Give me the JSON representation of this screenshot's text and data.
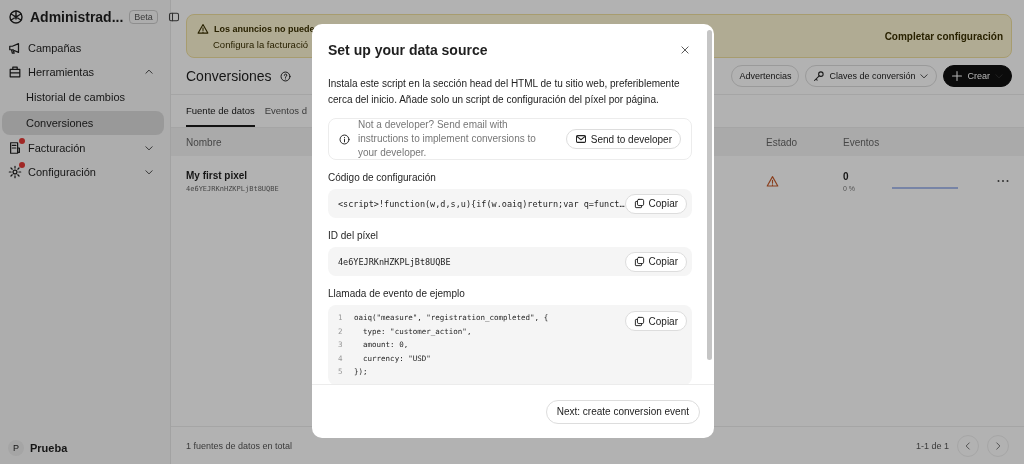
{
  "sidebar": {
    "brand": "Administrad...",
    "badge": "Beta",
    "items": [
      {
        "label": "Campañas",
        "selected": false,
        "alert": false
      },
      {
        "label": "Herramientas",
        "selected": false,
        "alert": false,
        "expanded": true,
        "children": [
          {
            "label": "Historial de cambios",
            "selected": false
          },
          {
            "label": "Conversiones",
            "selected": true
          }
        ]
      },
      {
        "label": "Facturación",
        "selected": false,
        "alert": true,
        "expanded": false
      },
      {
        "label": "Configuración",
        "selected": false,
        "alert": true,
        "expanded": false
      }
    ],
    "user": {
      "initial": "P",
      "name": "Prueba"
    }
  },
  "banner": {
    "title": "Los anuncios no puede",
    "text": "Configura la facturació",
    "action": "Completar configuración"
  },
  "header": {
    "title": "Conversiones",
    "buttons": [
      {
        "label": "Advertencias",
        "kind": "plain"
      },
      {
        "label": "Claves de conversión",
        "kind": "key"
      },
      {
        "label": "Crear",
        "kind": "primary"
      }
    ]
  },
  "tabs": [
    {
      "label": "Fuente de datos",
      "selected": true
    },
    {
      "label": "Eventos d",
      "selected": false
    }
  ],
  "table": {
    "columns": [
      "Nombre",
      "Estado",
      "Eventos"
    ],
    "rows": [
      {
        "name": "My first pixel",
        "id": "4e6YEJRKnHZKPLjBt8UQBE",
        "warning": true,
        "events": "0",
        "percent": "0 %"
      }
    ]
  },
  "footer": {
    "total": "1 fuentes de datos en total",
    "range": "1-1 de 1"
  },
  "modal": {
    "title": "Set up your data source",
    "description": "Instala este script en la sección head del HTML de tu sitio web, preferiblemente cerca del inicio. Añade solo un script de configuración del píxel por página.",
    "notice": {
      "text": "Not a developer? Send email with instructions to implement conversions to your developer.",
      "button": "Send to developer"
    },
    "sections": [
      {
        "label": "Código de configuración",
        "kind": "inline",
        "code": "<script>!function(w,d,s,u){if(w.oaiq)return;var q=funct…",
        "copy": "Copiar"
      },
      {
        "label": "ID del píxel",
        "kind": "inline",
        "code": "4e6YEJRKnHZKPLjBt8UQBE",
        "copy": "Copiar"
      },
      {
        "label": "Llamada de evento de ejemplo",
        "kind": "block",
        "copy": "Copiar",
        "lines": [
          {
            "number": "1",
            "code": "oaiq(\"measure\", \"registration_completed\", {"
          },
          {
            "number": "2",
            "code": "  type: \"customer_action\","
          },
          {
            "number": "3",
            "code": "  amount: 0,"
          },
          {
            "number": "4",
            "code": "  currency: \"USD\""
          },
          {
            "number": "5",
            "code": "});"
          }
        ]
      }
    ],
    "next_button": "Next: create conversion event"
  }
}
